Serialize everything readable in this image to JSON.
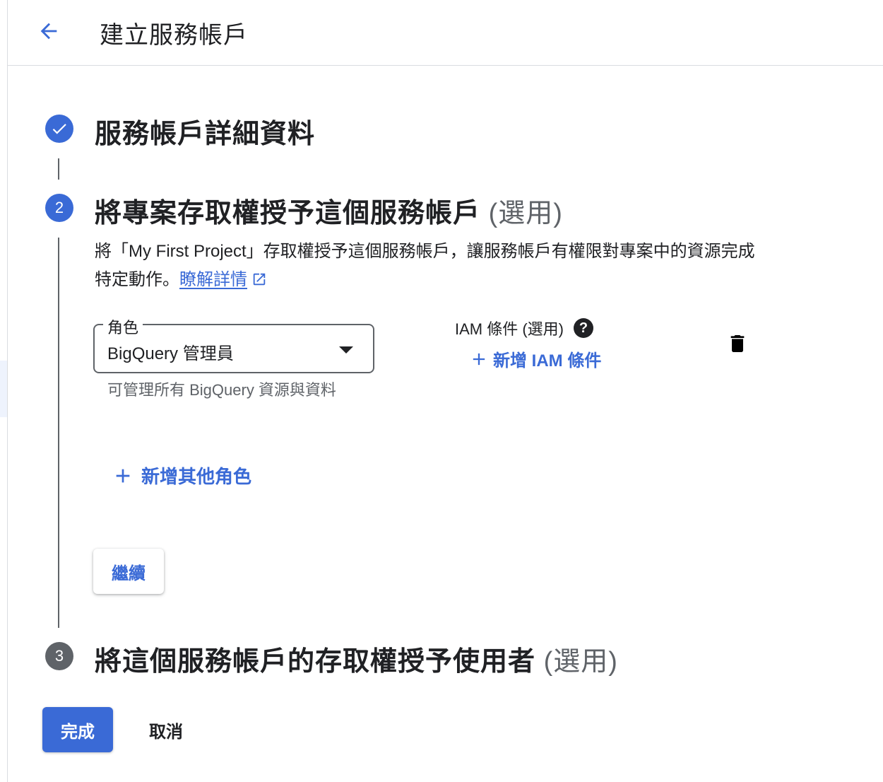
{
  "header": {
    "title": "建立服務帳戶",
    "back_icon": "arrow-left-icon"
  },
  "steps": [
    {
      "number": "1",
      "state": "completed",
      "icon": "check-icon",
      "title": "服務帳戶詳細資料",
      "optional": ""
    },
    {
      "number": "2",
      "state": "active",
      "title": "將專案存取權授予這個服務帳戶",
      "optional": "(選用)"
    },
    {
      "number": "3",
      "state": "pending",
      "title": "將這個服務帳戶的存取權授予使用者",
      "optional": "(選用)"
    }
  ],
  "step2": {
    "description": "將「My First Project」存取權授予這個服務帳戶，讓服務帳戶有權限對專案中的資源完成特定動作。",
    "learn_more": "瞭解詳情",
    "role": {
      "label": "角色",
      "value": "BigQuery 管理員",
      "help": "可管理所有 BigQuery 資源與資料"
    },
    "iam": {
      "label": "IAM 條件 (選用)",
      "add_condition": "新增 IAM 條件"
    },
    "add_role": "新增其他角色",
    "continue": "繼續"
  },
  "actions": {
    "done": "完成",
    "cancel": "取消"
  },
  "colors": {
    "accent": "#3a6ad6",
    "pending_step": "#5f6368",
    "text": "#202124"
  }
}
